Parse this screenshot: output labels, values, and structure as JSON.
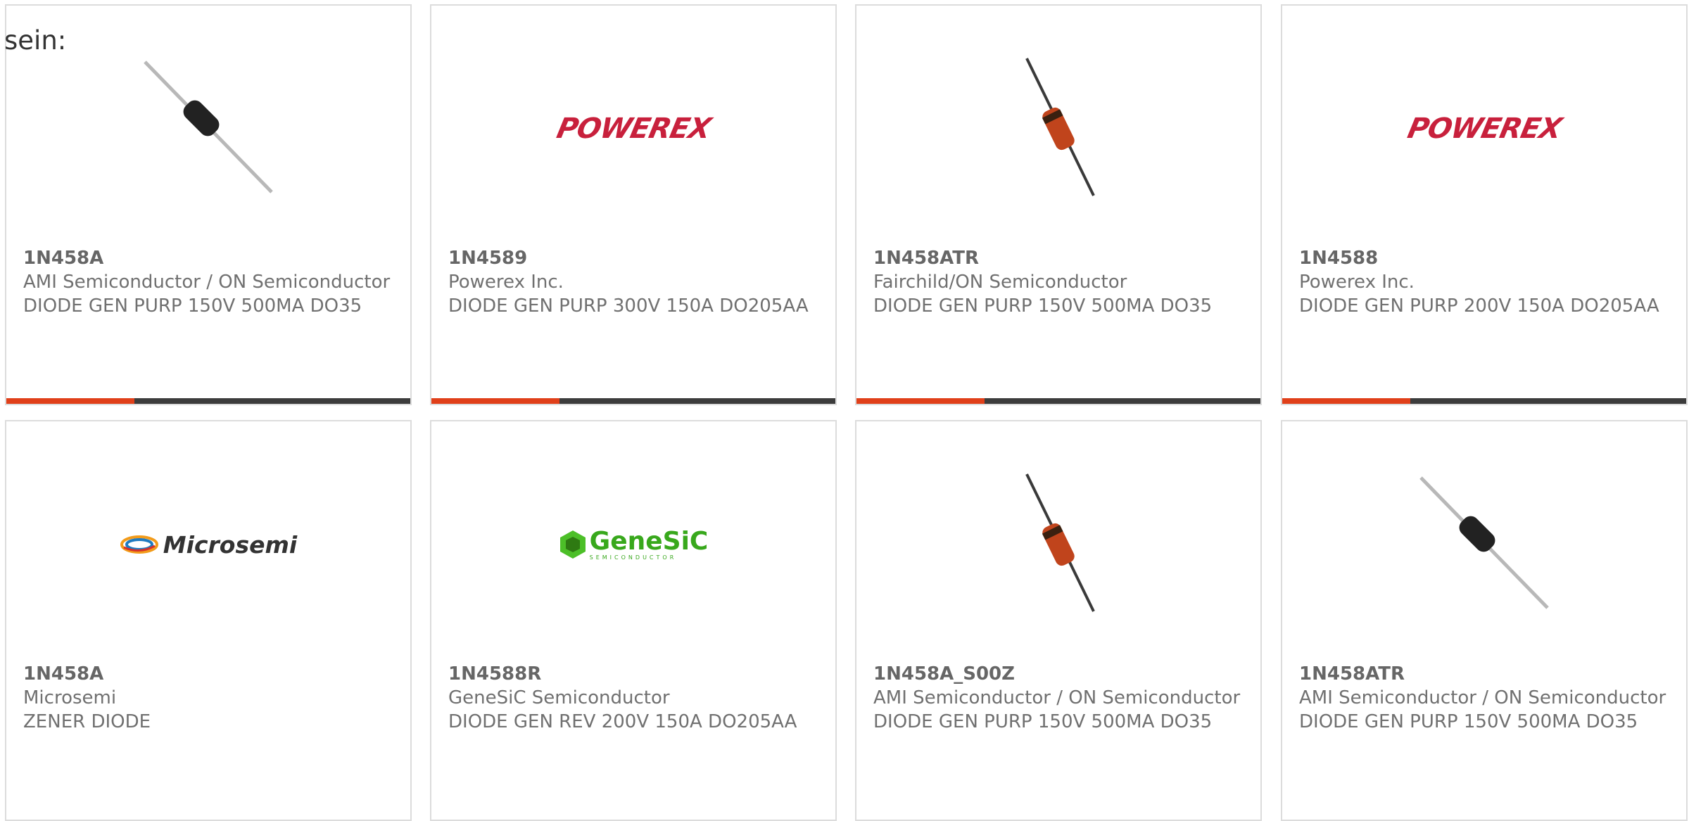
{
  "intro_text": "sein:",
  "products": [
    {
      "part": "1N458A",
      "manufacturer": "AMI Semiconductor / ON Semiconductor",
      "desc": "DIODE GEN PURP 150V 500MA DO35",
      "image": "axial-diode-black"
    },
    {
      "part": "1N4589",
      "manufacturer": "Powerex Inc.",
      "desc": "DIODE GEN PURP 300V 150A DO205AA",
      "image": "powerex-logo"
    },
    {
      "part": "1N458ATR",
      "manufacturer": "Fairchild/ON Semiconductor",
      "desc": "DIODE GEN PURP 150V 500MA DO35",
      "image": "glass-diode-red"
    },
    {
      "part": "1N4588",
      "manufacturer": "Powerex Inc.",
      "desc": "DIODE GEN PURP 200V 150A DO205AA",
      "image": "powerex-logo"
    },
    {
      "part": "1N458A",
      "manufacturer": "Microsemi",
      "desc": "ZENER DIODE",
      "image": "microsemi-logo"
    },
    {
      "part": "1N4588R",
      "manufacturer": "GeneSiC Semiconductor",
      "desc": "DIODE GEN REV 200V 150A DO205AA",
      "image": "genesic-logo"
    },
    {
      "part": "1N458A_S00Z",
      "manufacturer": "AMI Semiconductor / ON Semiconductor",
      "desc": "DIODE GEN PURP 150V 500MA DO35",
      "image": "glass-diode-red"
    },
    {
      "part": "1N458ATR",
      "manufacturer": "AMI Semiconductor / ON Semiconductor",
      "desc": "DIODE GEN PURP 150V 500MA DO35",
      "image": "axial-diode-black"
    }
  ],
  "logos": {
    "powerex": "POWEREX",
    "microsemi": "Microsemi",
    "genesic": "GeneSiC",
    "genesic_sub": "SEMICONDUCTOR"
  },
  "colors": {
    "accent": "#e0401a",
    "bar": "#3c3c3c",
    "powerex": "#c8203c",
    "genesic": "#38a81c"
  }
}
